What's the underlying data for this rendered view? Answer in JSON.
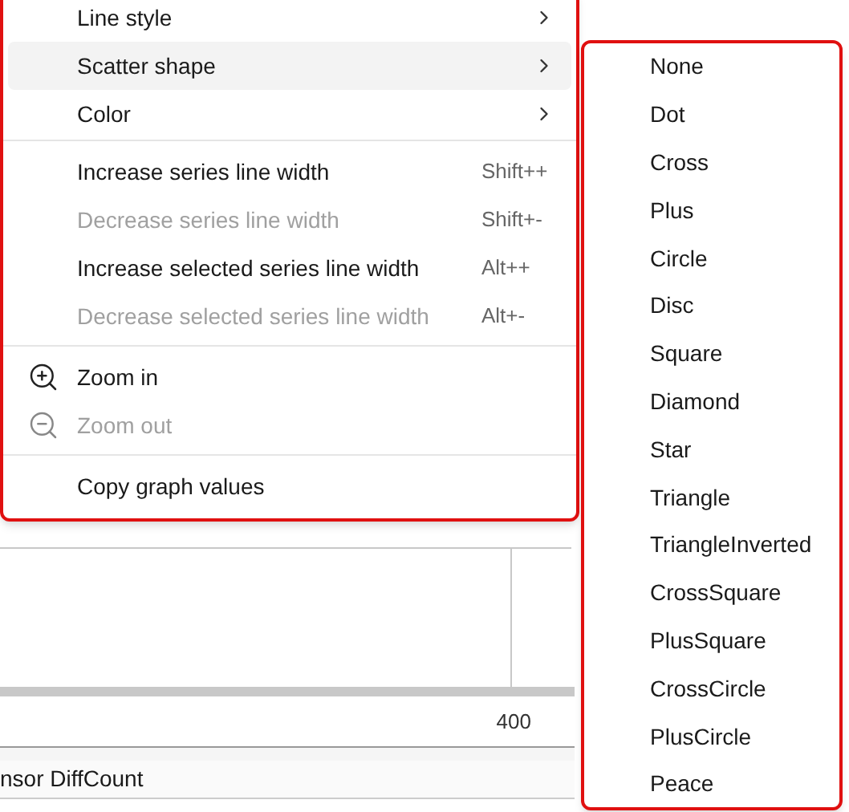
{
  "chart": {
    "x_tick": "400"
  },
  "legend": {
    "label": "nsor DiffCount"
  },
  "menu": {
    "sections": [
      [
        {
          "kind": "submenu",
          "label": "Line style",
          "selected": false,
          "disabled": false
        },
        {
          "kind": "submenu",
          "label": "Scatter shape",
          "selected": true,
          "disabled": false
        },
        {
          "kind": "submenu",
          "label": "Color",
          "selected": false,
          "disabled": false
        }
      ],
      [
        {
          "kind": "action",
          "label": "Increase series line width",
          "shortcut": "Shift++",
          "selected": false,
          "disabled": false
        },
        {
          "kind": "action",
          "label": "Decrease series line width",
          "shortcut": "Shift+-",
          "selected": false,
          "disabled": true
        },
        {
          "kind": "action",
          "label": "Increase selected series line width",
          "shortcut": "Alt++",
          "selected": false,
          "disabled": false
        },
        {
          "kind": "action",
          "label": "Decrease selected series line width",
          "shortcut": "Alt+-",
          "selected": false,
          "disabled": true
        }
      ],
      [
        {
          "kind": "zoom_in",
          "label": "Zoom in",
          "selected": false,
          "disabled": false
        },
        {
          "kind": "zoom_out",
          "label": "Zoom out",
          "selected": false,
          "disabled": true
        }
      ],
      [
        {
          "kind": "action",
          "label": "Copy graph values",
          "selected": false,
          "disabled": false
        }
      ]
    ]
  },
  "submenu": {
    "items": [
      "None",
      "Dot",
      "Cross",
      "Plus",
      "Circle",
      "Disc",
      "Square",
      "Diamond",
      "Star",
      "Triangle",
      "TriangleInverted",
      "CrossSquare",
      "PlusSquare",
      "CrossCircle",
      "PlusCircle",
      "Peace"
    ]
  }
}
